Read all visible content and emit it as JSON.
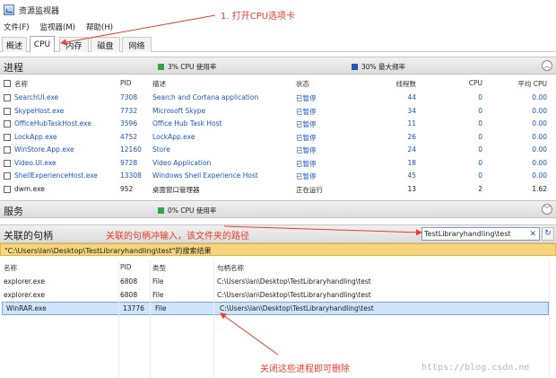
{
  "window": {
    "title": "资源监视器"
  },
  "menu": [
    "文件(F)",
    "监视器(M)",
    "帮助(H)"
  ],
  "tabs": [
    "概述",
    "CPU",
    "内存",
    "磁盘",
    "网络"
  ],
  "processes": {
    "title": "进程",
    "cpu_usage": "3% CPU 使用率",
    "max_freq": "30% 最大频率",
    "columns": [
      "名称",
      "PID",
      "描述",
      "状态",
      "线程数",
      "CPU",
      "平均 CPU"
    ],
    "rows": [
      {
        "name": "SearchUI.exe",
        "pid": "7308",
        "desc": "Search and Cortana application",
        "status": "已暂停",
        "threads": "44",
        "cpu": "0",
        "avg": "0.00"
      },
      {
        "name": "SkypeHost.exe",
        "pid": "7732",
        "desc": "Microsoft Skype",
        "status": "已暂停",
        "threads": "34",
        "cpu": "0",
        "avg": "0.00"
      },
      {
        "name": "OfficeHubTaskHost.exe",
        "pid": "3596",
        "desc": "Office Hub Task Host",
        "status": "已暂停",
        "threads": "11",
        "cpu": "0",
        "avg": "0.00"
      },
      {
        "name": "LockApp.exe",
        "pid": "4752",
        "desc": "LockApp.exe",
        "status": "已暂停",
        "threads": "26",
        "cpu": "0",
        "avg": "0.00"
      },
      {
        "name": "WinStore.App.exe",
        "pid": "12160",
        "desc": "Store",
        "status": "已暂停",
        "threads": "24",
        "cpu": "0",
        "avg": "0.00"
      },
      {
        "name": "Video.UI.exe",
        "pid": "9728",
        "desc": "Video Application",
        "status": "已暂停",
        "threads": "18",
        "cpu": "0",
        "avg": "0.00"
      },
      {
        "name": "ShellExperienceHost.exe",
        "pid": "13308",
        "desc": "Windows Shell Experience Host",
        "status": "已暂停",
        "threads": "45",
        "cpu": "0",
        "avg": "0.00"
      },
      {
        "name": "dwm.exe",
        "pid": "952",
        "desc": "桌面窗口管理器",
        "status": "正在运行",
        "threads": "13",
        "cpu": "2",
        "avg": "1.62"
      }
    ]
  },
  "services": {
    "title": "服务",
    "cpu_usage": "0% CPU 使用率"
  },
  "handles": {
    "title": "关联的句柄",
    "search_value": "TestLibraryhandling\\test",
    "result_banner": "\"C:\\Users\\lan\\Desktop\\TestLibraryhandling\\test\"的搜索结果",
    "columns": [
      "名称",
      "PID",
      "类型",
      "句柄名称"
    ],
    "rows": [
      {
        "name": "explorer.exe",
        "pid": "6808",
        "type": "File",
        "handle": "C:\\Users\\lan\\Desktop\\TestLibraryhandling\\test"
      },
      {
        "name": "explorer.exe",
        "pid": "6808",
        "type": "File",
        "handle": "C:\\Users\\lan\\Desktop\\TestLibraryhandling\\test"
      },
      {
        "name": "WinRAR.exe",
        "pid": "13776",
        "type": "File",
        "handle": "C:\\Users\\lan\\Desktop\\TestLibraryhandling\\test"
      }
    ]
  },
  "annotations": {
    "a1": "1. 打开CPU选项卡",
    "a2": "关联的句柄冲输入，该文件夹的路径",
    "a3": "关闭这些进程即可删除"
  },
  "watermark": "https://blog.csdn.ne",
  "colors": {
    "annotation": "#e8402d",
    "process_name": "#1a56c8",
    "cpu_green": "#2aa84a",
    "freq_blue": "#2a55b8",
    "banner": "#f7d57a"
  }
}
